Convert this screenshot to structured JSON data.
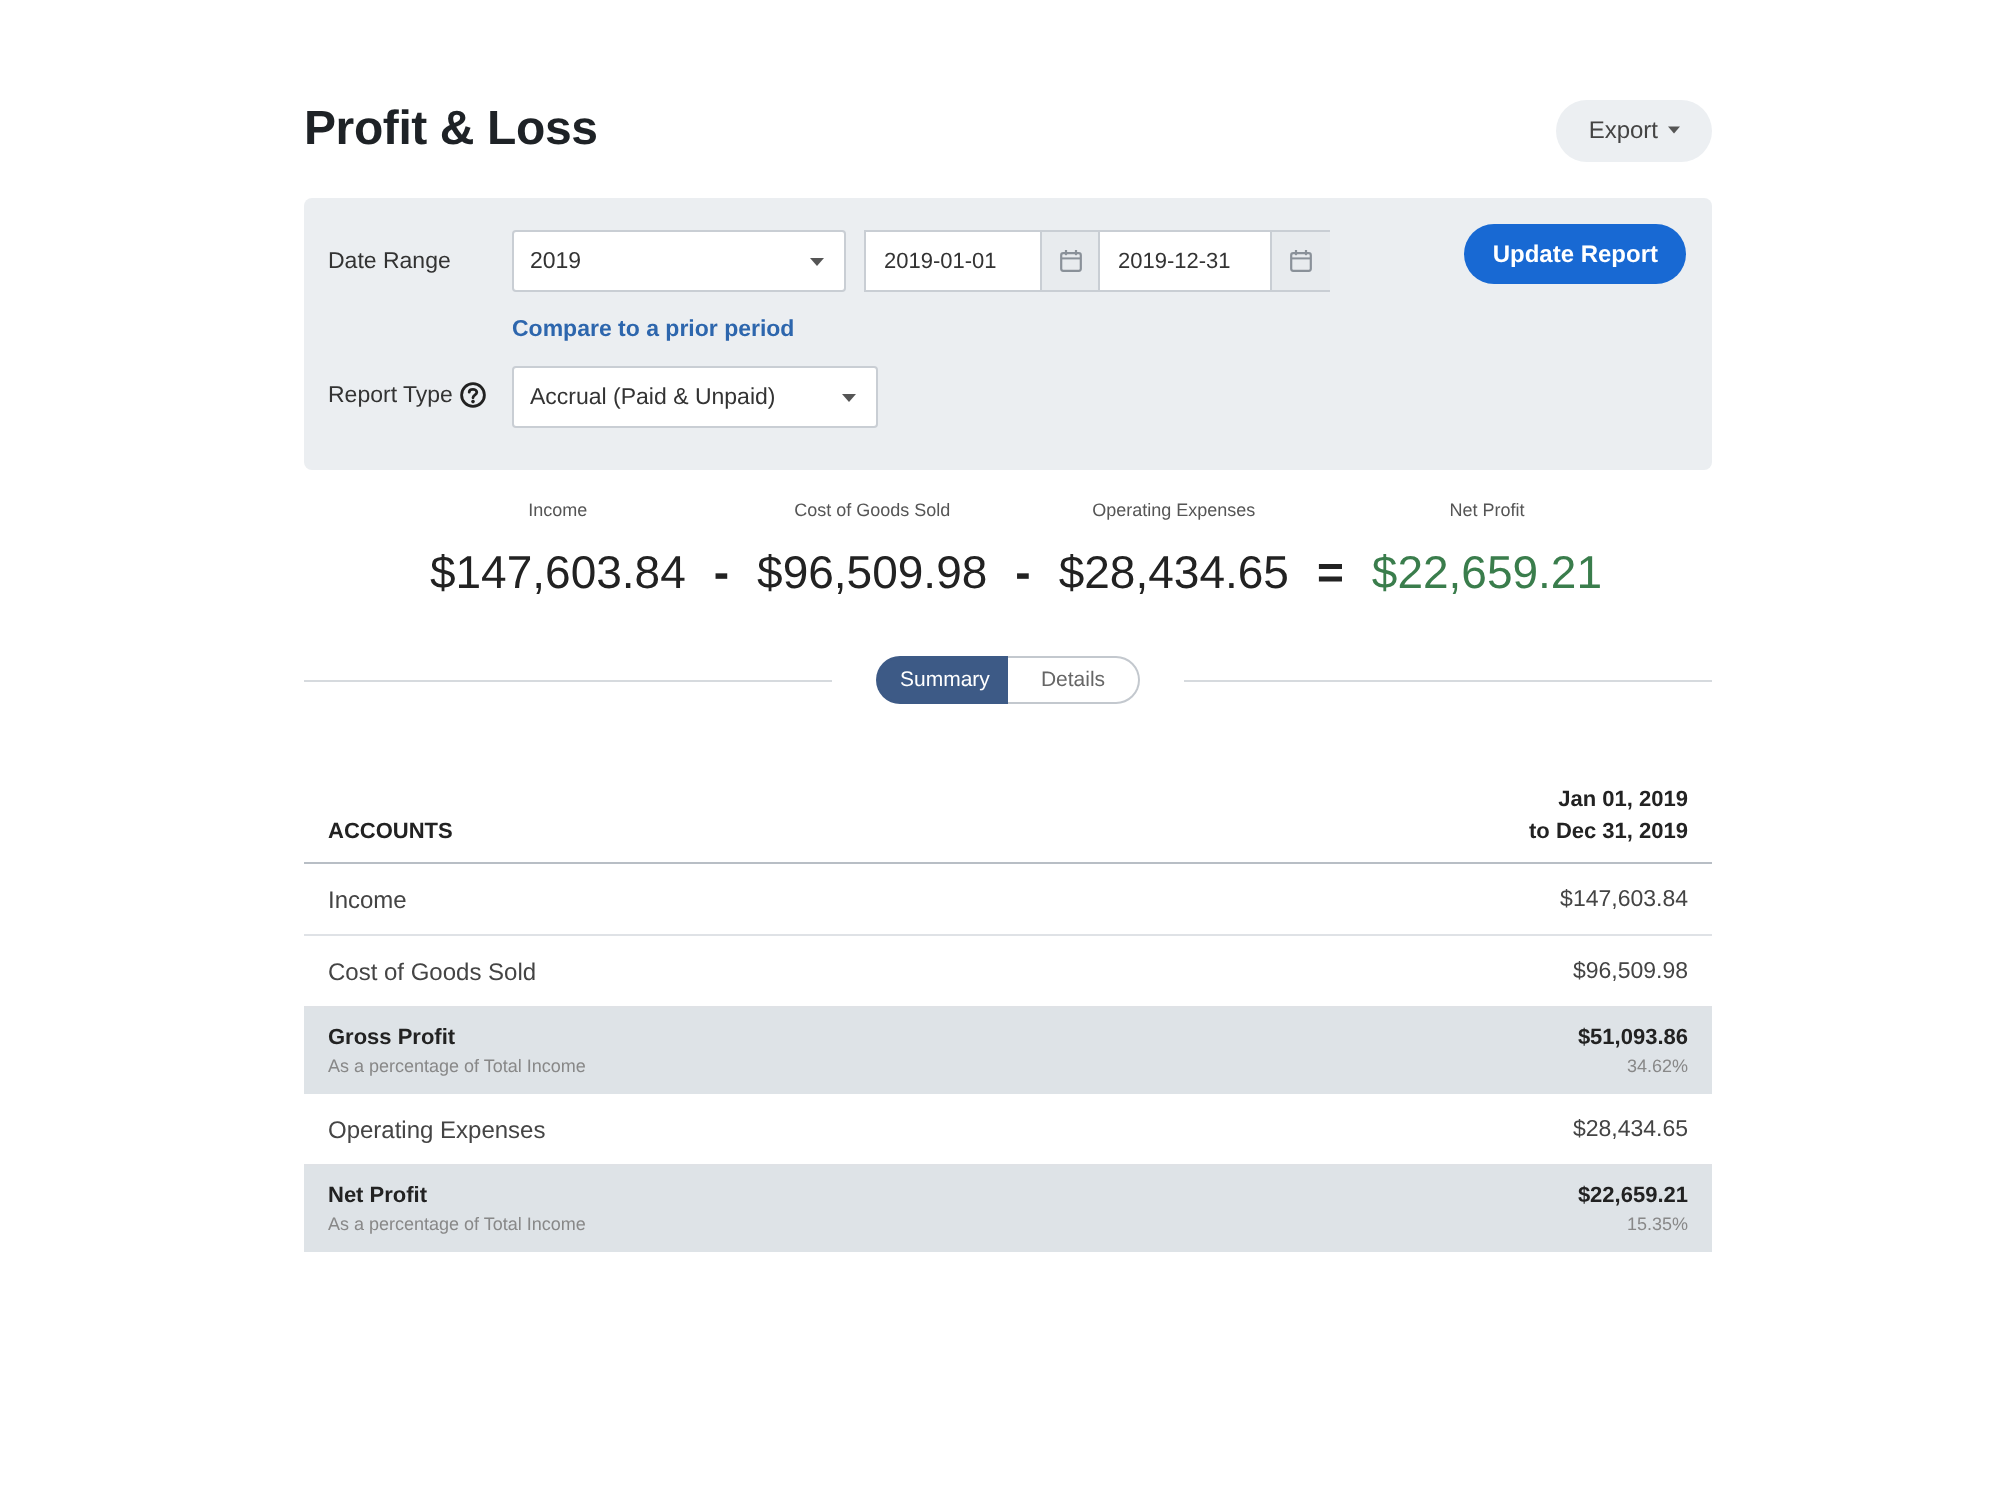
{
  "page": {
    "title": "Profit & Loss"
  },
  "export_button": {
    "label": "Export"
  },
  "filters": {
    "date_range": {
      "label": "Date Range",
      "period": "2019",
      "start_date": "2019-01-01",
      "end_date": "2019-12-31",
      "compare_link": "Compare to a prior period"
    },
    "report_type": {
      "label": "Report Type",
      "value": "Accrual (Paid & Unpaid)"
    },
    "update_button": "Update Report"
  },
  "summary": [
    {
      "kind": "amount",
      "label": "Income",
      "value": "$147,603.84"
    },
    {
      "kind": "operator",
      "symbol": "-"
    },
    {
      "kind": "amount",
      "label": "Cost of Goods Sold",
      "value": "$96,509.98"
    },
    {
      "kind": "operator",
      "symbol": "-"
    },
    {
      "kind": "amount",
      "label": "Operating Expenses",
      "value": "$28,434.65"
    },
    {
      "kind": "operator",
      "symbol": "="
    },
    {
      "kind": "result",
      "label": "Net Profit",
      "value": "$22,659.21"
    }
  ],
  "view_toggle": [
    {
      "label": "Summary",
      "selected": true
    },
    {
      "label": "Details",
      "selected": false
    }
  ],
  "table": {
    "columns": [
      {
        "lines": [
          "ACCOUNTS"
        ]
      },
      {
        "lines": [
          "Jan 01, 2019",
          "to Dec 31, 2019"
        ]
      }
    ],
    "rows": [
      {
        "kind": "line",
        "account": "Income",
        "amount": "$147,603.84"
      },
      {
        "kind": "line",
        "account": "Cost of Goods Sold",
        "amount": "$96,509.98"
      },
      {
        "kind": "subtotal",
        "account": "Gross Profit",
        "amount": "$51,093.86",
        "note": "As a percentage of Total Income",
        "percent": "34.62%"
      },
      {
        "kind": "line",
        "account": "Operating Expenses",
        "amount": "$28,434.65"
      },
      {
        "kind": "subtotal",
        "account": "Net Profit",
        "amount": "$22,659.21",
        "note": "As a percentage of Total Income",
        "percent": "15.35%"
      }
    ]
  }
}
